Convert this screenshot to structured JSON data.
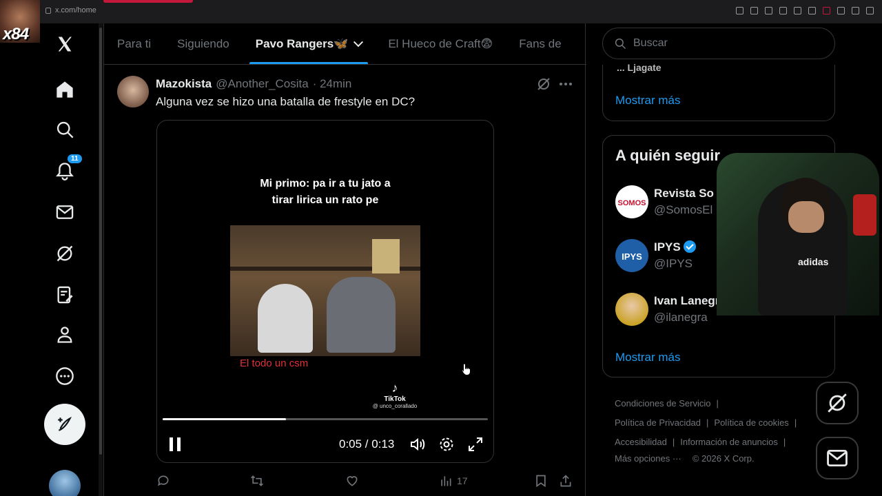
{
  "browser": {
    "url": "x.com/home"
  },
  "streamer": {
    "tag": "x84"
  },
  "nav": {
    "notifications_count": "11"
  },
  "tabs": [
    {
      "label": "Para ti"
    },
    {
      "label": "Siguiendo"
    },
    {
      "label": "Pavo Rangers🦋"
    },
    {
      "label": "El Hueco de Craft😨"
    },
    {
      "label": "Fans de"
    }
  ],
  "tweet": {
    "name": "Mazokista",
    "handle": "@Another_Cosita",
    "time": "· 24min",
    "text": "Alguna vez se hizo una batalla de frestyle en DC?",
    "video": {
      "caption_line1": "Mi primo: pa ir a tu jato a",
      "caption_line2": "tirar lirica un rato pe",
      "subtitle": "El todo un csm",
      "tiktok_label": "TikTok",
      "tiktok_user": "@ unco_corallado",
      "time": "0:05 / 0:13",
      "progress": 0.38
    },
    "views": "17"
  },
  "search": {
    "placeholder": "Buscar"
  },
  "trends": {
    "cut_text": "... Ljagate",
    "more": "Mostrar más"
  },
  "who_to_follow": {
    "title": "A quién seguir",
    "accounts": [
      {
        "name": "Revista So",
        "handle": "@SomosEl"
      },
      {
        "name": "IPYS",
        "handle": "@IPYS"
      },
      {
        "name": "Ivan Lanegr",
        "handle": "@ilanegra"
      }
    ],
    "more": "Mostrar más"
  },
  "webcam": {
    "shirt_text": "adidas"
  },
  "footer": {
    "terms": "Condiciones de Servicio",
    "privacy": "Política de Privacidad",
    "cookies": "Política de cookies",
    "accessibility": "Accesibilidad",
    "ads": "Información de anuncios",
    "more": "Más opciones ···",
    "copyright": "© 2026 X Corp."
  }
}
